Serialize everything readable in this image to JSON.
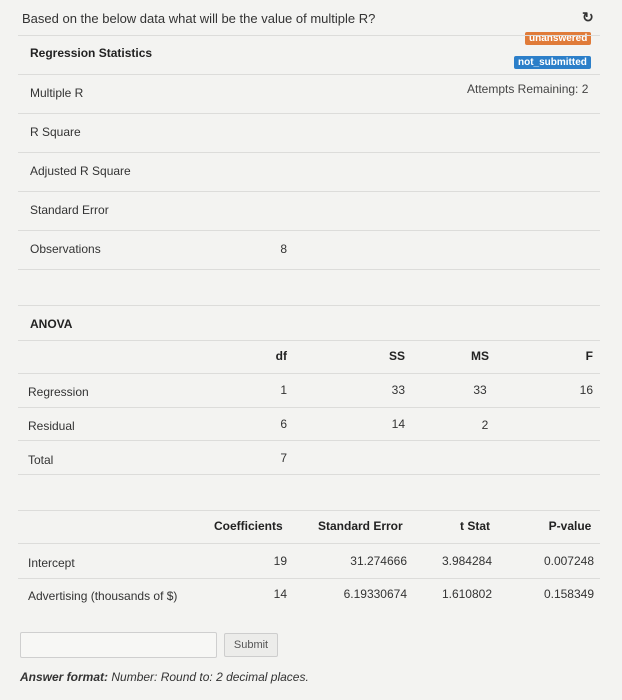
{
  "question": "Based on the below data what will be the value of multiple R?",
  "status": {
    "unanswered": "unanswered",
    "not_submitted": "not_submitted",
    "attempts": "Attempts Remaining: 2",
    "refresh_icon": "refresh-icon",
    "colors": {
      "unanswered": "#e07b39",
      "not_submitted": "#2c7fc9"
    }
  },
  "regression_stats": {
    "title": "Regression Statistics",
    "rows": [
      {
        "label": "Multiple R",
        "value": ""
      },
      {
        "label": "R Square",
        "value": ""
      },
      {
        "label": "Adjusted R Square",
        "value": ""
      },
      {
        "label": "Standard Error",
        "value": ""
      },
      {
        "label": "Observations",
        "value": "8"
      }
    ]
  },
  "anova": {
    "title": "ANOVA",
    "headers": [
      "df",
      "SS",
      "MS",
      "F"
    ],
    "rows": [
      {
        "label": "Regression",
        "df": "1",
        "ss": "33",
        "ms": "33",
        "f": "16"
      },
      {
        "label": "Residual",
        "df": "6",
        "ss": "14",
        "ms": "2",
        "f": ""
      },
      {
        "label": "Total",
        "df": "7",
        "ss": "",
        "ms": "",
        "f": ""
      }
    ]
  },
  "coefficients": {
    "headers": [
      "Coefficients",
      "Standard Error",
      "t Stat",
      "P-value"
    ],
    "rows": [
      {
        "label": "Intercept",
        "coef": "19",
        "se": "31.274666",
        "t": "3.984284",
        "p": "0.007248"
      },
      {
        "label": "Advertising (thousands of $)",
        "coef": "14",
        "se": "6.19330674",
        "t": "1.610802",
        "p": "0.158349"
      }
    ]
  },
  "answer": {
    "value": "",
    "submit_label": "Submit",
    "format_label": "Answer format:",
    "format_text": "Number: Round to: 2 decimal places."
  }
}
